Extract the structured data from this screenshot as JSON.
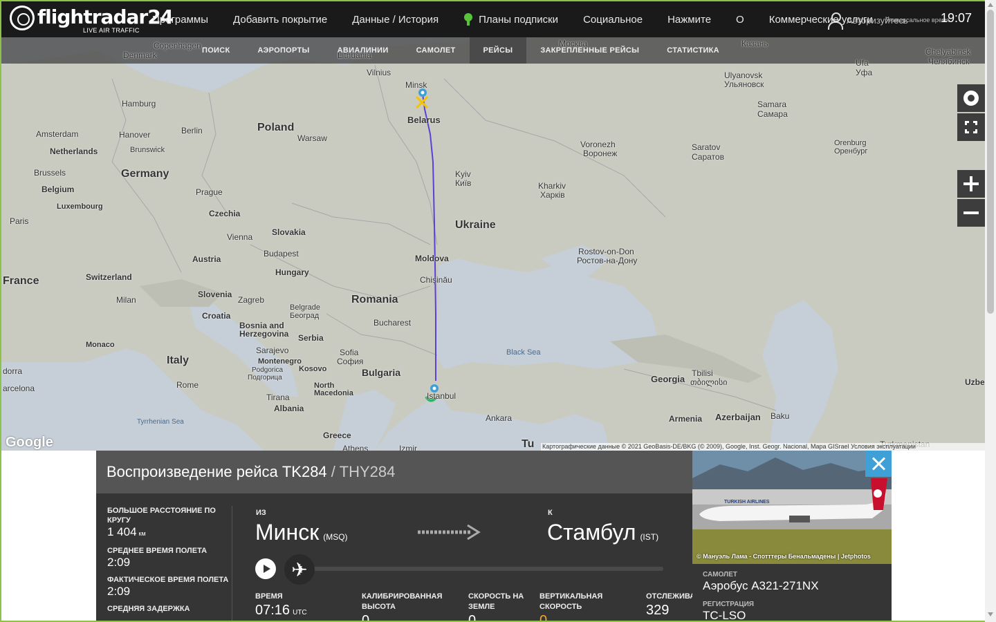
{
  "header": {
    "logo_text": "flightradar24",
    "logo_tagline": "LIVE AIR TRAFFIC",
    "nav": [
      "Программы",
      "Добавить покрытие",
      "Данные / История",
      "Планы подписки",
      "Социальное",
      "Нажмите",
      "О",
      "Коммерческие услуги"
    ],
    "user_label": "Авторизуйтесь",
    "utc_label": "Универсальное время",
    "clock": "19:07"
  },
  "subnav": [
    "ПОИСК",
    "АЭРОПОРТЫ",
    "АВИАЛИНИИ",
    "САМОЛЕТ",
    "РЕЙСЫ",
    "ЗАКРЕПЛЕННЫЕ РЕЙСЫ",
    "СТАТИСТИКА"
  ],
  "subnav_active": "РЕЙСЫ",
  "map": {
    "labels": [
      "Denmark",
      "Copenhagen",
      "Lithuania",
      "Vilnius",
      "Minsk",
      "Belarus",
      "Москва",
      "Казань",
      "Chelyabinsk",
      "Челябинск",
      "Ufa",
      "Уфа",
      "Ulyanovsk",
      "Ульяновск",
      "Samara",
      "Самара",
      "Hamburg",
      "Amsterdam",
      "Netherlands",
      "Hanover",
      "Brunswick",
      "Berlin",
      "Poland",
      "Warsaw",
      "Voronezh",
      "Воронеж",
      "Saratov",
      "Саратов",
      "Orenburg",
      "Оренбург",
      "Brussels",
      "Belgium",
      "Germany",
      "Kyiv",
      "Київ",
      "Kharkiv",
      "Харків",
      "Luxembourg",
      "Prague",
      "Czechia",
      "Paris",
      "Ukraine",
      "Vienna",
      "Slovakia",
      "Budapest",
      "Austria",
      "Hungary",
      "Moldova",
      "Chișinău",
      "Rostov-on-Don",
      "Ростов-на-Дону",
      "France",
      "Switzerland",
      "Slovenia",
      "Zagreb",
      "Milan",
      "Croatia",
      "Belgrade",
      "Београд",
      "Romania",
      "Bucharest",
      "Bosnia and Herzegovina",
      "Serbia",
      "Monaco",
      "Sarajevo",
      "Italy",
      "Montenegro",
      "Podgorica",
      "Подгорица",
      "Sofia",
      "София",
      "Bulgaria",
      "Kosovo",
      "Black Sea",
      "Georgia",
      "Tbilisi",
      "თბილისი",
      "dorra",
      "arcelona",
      "Rome",
      "North Macedonia",
      "Tirana",
      "Albania",
      "Istanbul",
      "Ankara",
      "Armenia",
      "Azerbaijan",
      "Baku",
      "Uzbe",
      "Tyrrhenian Sea",
      "Greece",
      "Athens",
      "Izmir",
      "Tu",
      "Turkmenistan"
    ],
    "attribution": "Картографические данные © 2021 GeoBasis-DE/BKG (© 2009), Google, Inst. Geogr. Nacional, Mapa GISrael  Условия эксплуатации",
    "google_logo": "Google"
  },
  "panel": {
    "title_prefix": "Воспроизведение рейса",
    "flight": "TK284",
    "separator": " / ",
    "callsign": "THY284",
    "stats": [
      {
        "label": "БОЛЬШОЕ РАССТОЯНИЕ ПО КРУГУ",
        "value": "1 404",
        "unit": "км"
      },
      {
        "label": "СРЕДНЕЕ ВРЕМЯ ПОЛЕТА",
        "value": "2:09",
        "unit": ""
      },
      {
        "label": "ФАКТИЧЕСКОЕ ВРЕМЯ ПОЛЕТА",
        "value": "2:09",
        "unit": ""
      },
      {
        "label": "СРЕДНЯЯ ЗАДЕРЖКА",
        "value": "",
        "unit": ""
      }
    ],
    "from_label": "ИЗ",
    "from_city": "Минск",
    "from_code": "(MSQ)",
    "to_label": "К",
    "to_city": "Стамбул",
    "to_code": "(IST)",
    "metrics": [
      {
        "label": "ВРЕМЯ",
        "value": "07:16",
        "unit": "UTC"
      },
      {
        "label": "КАЛИБРИРОВАННАЯ ВЫСОТА",
        "value": "0",
        "unit": ""
      },
      {
        "label": "СКОРОСТЬ НА ЗЕМЛЕ",
        "value": "0",
        "unit": ""
      },
      {
        "label": "ВЕРТИКАЛЬНАЯ СКОРОСТЬ",
        "value": "0",
        "unit": ""
      },
      {
        "label": "ОТСЛЕЖИВАТЬ",
        "value": "329",
        "unit": ""
      }
    ]
  },
  "aircraft": {
    "photo_credit": "© Мануэль Лама - Спотттеры Бенальмадены | Jetphotos",
    "livery_text": "TURKISH AIRLINES",
    "type_label": "САМОЛЕТ",
    "type_value": "Аэробус A321-271NX",
    "reg_label": "РЕГИСТРАЦИЯ",
    "reg_value": "TC-LSO"
  },
  "colors": {
    "accent_green": "#58c23b",
    "route_line": "#5b3fd6",
    "close_button": "#3fa0d8",
    "vertical_speed": "#f5a623"
  }
}
